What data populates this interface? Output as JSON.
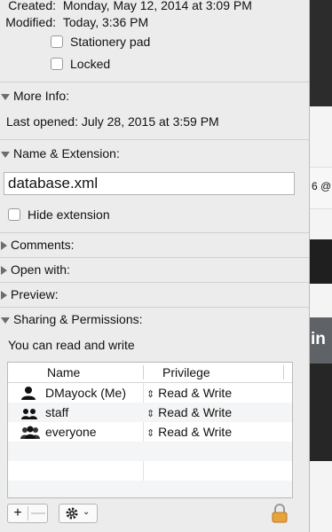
{
  "general": {
    "created_label": "Created:",
    "created_value": "Monday, May 12, 2014 at 3:09 PM",
    "modified_label": "Modified:",
    "modified_value": "Today, 3:36 PM",
    "stationery_label": "Stationery pad",
    "locked_label": "Locked"
  },
  "more_info": {
    "header": "More Info:",
    "last_opened": "Last opened: July 28, 2015 at 3:59 PM"
  },
  "name_extension": {
    "header": "Name & Extension:",
    "filename": "database.xml",
    "hide_extension_label": "Hide extension"
  },
  "sections": {
    "comments": "Comments:",
    "open_with": "Open with:",
    "preview": "Preview:"
  },
  "sharing": {
    "header": "Sharing & Permissions:",
    "summary": "You can read and write",
    "col_name": "Name",
    "col_privilege": "Privilege",
    "rows": [
      {
        "name": "DMayock (Me)",
        "privilege": "Read & Write",
        "icon": "single-user-icon"
      },
      {
        "name": "staff",
        "privilege": "Read & Write",
        "icon": "group-icon"
      },
      {
        "name": "everyone",
        "privilege": "Read & Write",
        "icon": "everyone-icon"
      }
    ]
  },
  "toolbar": {
    "add_label": "+",
    "remove_label": "—",
    "action_icon": "gear-icon",
    "lock_icon": "lock-icon"
  },
  "background_window": {
    "fragment_1": "6 @",
    "fragment_2": "in"
  }
}
